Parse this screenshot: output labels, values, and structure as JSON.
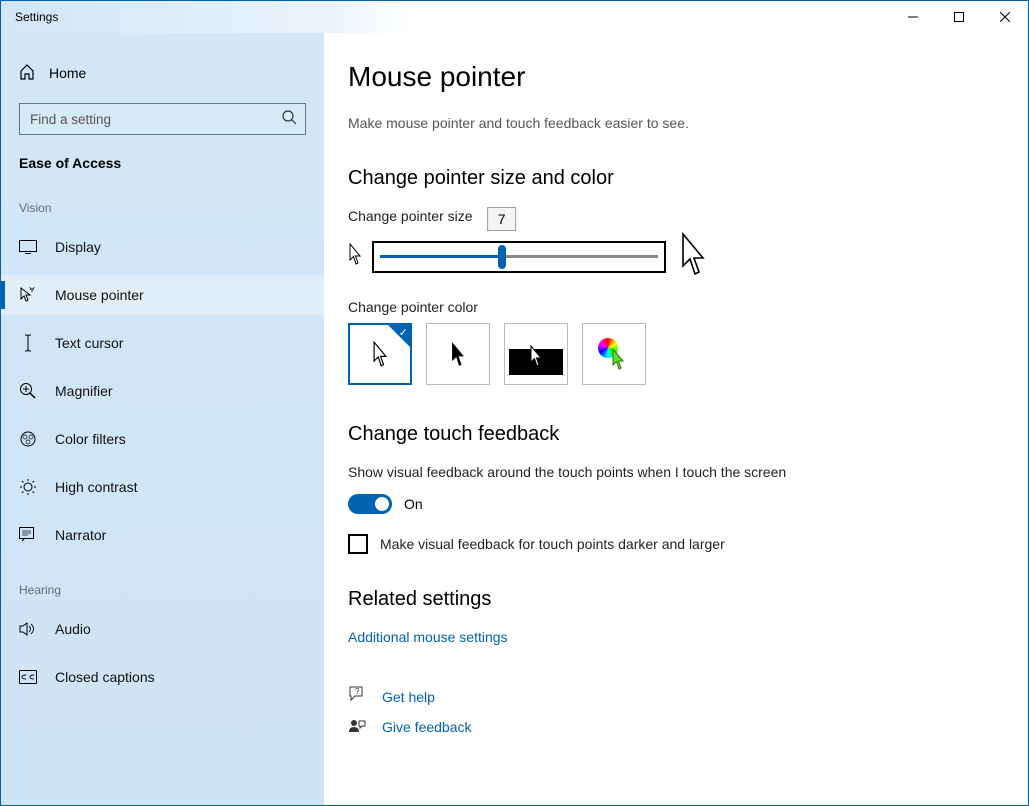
{
  "window": {
    "title": "Settings"
  },
  "sidebar": {
    "home": "Home",
    "search_placeholder": "Find a setting",
    "section": "Ease of Access",
    "groups": [
      {
        "label": "Vision",
        "items": [
          {
            "id": "display",
            "label": "Display"
          },
          {
            "id": "mouse-pointer",
            "label": "Mouse pointer",
            "active": true
          },
          {
            "id": "text-cursor",
            "label": "Text cursor"
          },
          {
            "id": "magnifier",
            "label": "Magnifier"
          },
          {
            "id": "color-filters",
            "label": "Color filters"
          },
          {
            "id": "high-contrast",
            "label": "High contrast"
          },
          {
            "id": "narrator",
            "label": "Narrator"
          }
        ]
      },
      {
        "label": "Hearing",
        "items": [
          {
            "id": "audio",
            "label": "Audio"
          },
          {
            "id": "closed-captions",
            "label": "Closed captions"
          }
        ]
      }
    ]
  },
  "page": {
    "heading": "Mouse pointer",
    "description": "Make mouse pointer and touch feedback easier to see.",
    "size_section": {
      "heading": "Change pointer size and color",
      "size_label": "Change pointer size",
      "size_value": "7",
      "color_label": "Change pointer color"
    },
    "touch_section": {
      "heading": "Change touch feedback",
      "desc": "Show visual feedback around the touch points when I touch the screen",
      "toggle_state": "On",
      "checkbox_label": "Make visual feedback for touch points darker and larger"
    },
    "related": {
      "heading": "Related settings",
      "link": "Additional mouse settings"
    },
    "help": {
      "get_help": "Get help",
      "feedback": "Give feedback"
    }
  }
}
